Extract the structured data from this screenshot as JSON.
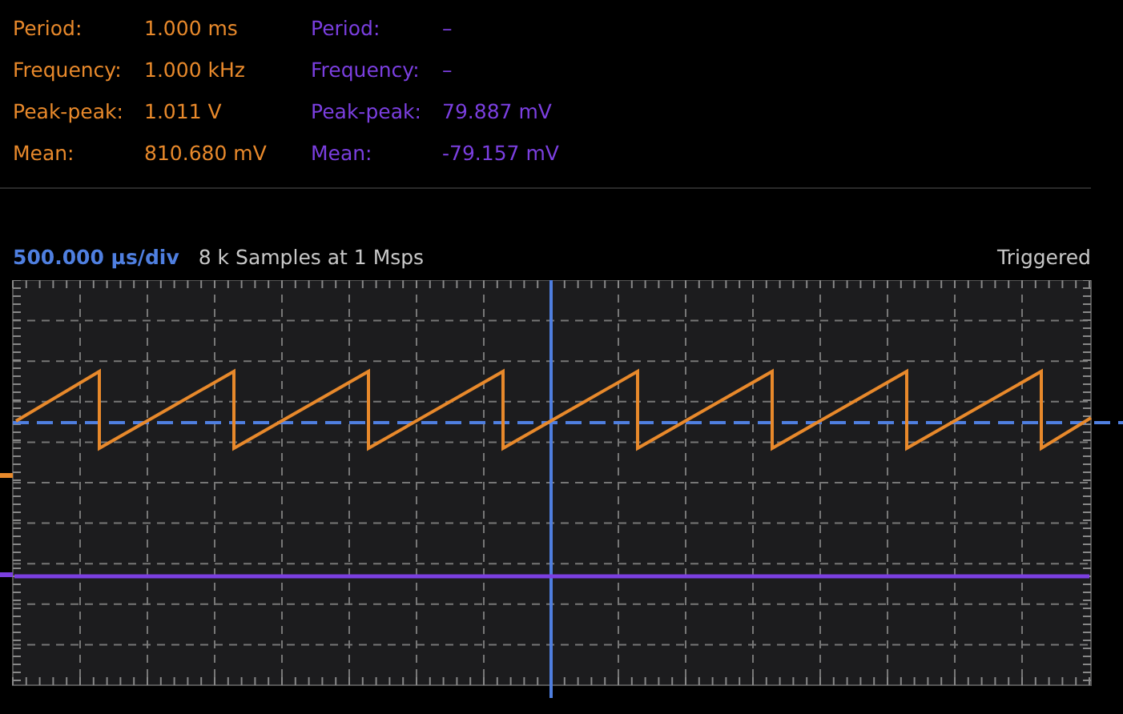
{
  "channels": [
    {
      "kind": "sawtooth",
      "color": "#e8892b",
      "measurements": [
        {
          "label": "Period:",
          "value": "1.000 ms"
        },
        {
          "label": "Frequency:",
          "value": "1.000 kHz"
        },
        {
          "label": "Peak-peak:",
          "value": "1.011 V"
        },
        {
          "label": "Mean:",
          "value": "810.680 mV"
        }
      ]
    },
    {
      "kind": "flat",
      "color": "#7b3fe0",
      "measurements": [
        {
          "label": "Period:",
          "value": "–"
        },
        {
          "label": "Frequency:",
          "value": "–"
        },
        {
          "label": "Peak-peak:",
          "value": "79.887 mV"
        },
        {
          "label": "Mean:",
          "value": "-79.157 mV"
        }
      ]
    }
  ],
  "timebase": "500.000 µs/div",
  "samples": "8 k Samples at 1 Msps",
  "status": "Triggered"
}
